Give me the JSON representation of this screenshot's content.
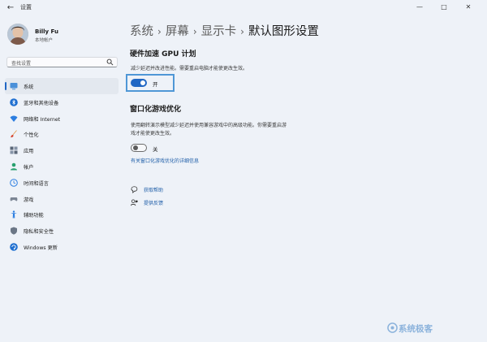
{
  "window": {
    "title": "设置",
    "back_glyph": "←",
    "minimize_glyph": "—",
    "maximize_glyph": "□",
    "close_glyph": "✕"
  },
  "account": {
    "name": "Billy Fu",
    "type": "本地帐户"
  },
  "search": {
    "placeholder": "查找设置"
  },
  "sidebar": {
    "items": [
      {
        "label": "系统",
        "icon": "system-icon",
        "active": true
      },
      {
        "label": "蓝牙和其他设备",
        "icon": "bluetooth-icon"
      },
      {
        "label": "网络和 Internet",
        "icon": "network-icon"
      },
      {
        "label": "个性化",
        "icon": "personalization-icon"
      },
      {
        "label": "应用",
        "icon": "apps-icon"
      },
      {
        "label": "帐户",
        "icon": "accounts-icon"
      },
      {
        "label": "时间和语言",
        "icon": "time-language-icon"
      },
      {
        "label": "游戏",
        "icon": "gaming-icon"
      },
      {
        "label": "辅助功能",
        "icon": "accessibility-icon"
      },
      {
        "label": "隐私和安全性",
        "icon": "privacy-icon"
      },
      {
        "label": "Windows 更新",
        "icon": "windows-update-icon"
      }
    ]
  },
  "breadcrumb": {
    "items": [
      "系统",
      "屏幕",
      "显示卡"
    ],
    "separator": "›",
    "current": "默认图形设置"
  },
  "gpu_scheduling": {
    "title": "硬件加速 GPU 计划",
    "description": "减少延迟并改进性能。需要重启电脑才能使更改生效。",
    "state": "开",
    "enabled": true
  },
  "windowed_games": {
    "title": "窗口化游戏优化",
    "description_line1": "使用翻转演示模型减少延迟并使用兼容游戏中的高级功能。你需要重启游",
    "description_line2": "戏才能使更改生效。",
    "state": "关",
    "enabled": false,
    "more_link": "有关窗口化游戏优化的详细信息"
  },
  "help": {
    "get_help": "获取帮助",
    "feedback": "提供反馈"
  },
  "watermark": {
    "text": "系统极客"
  },
  "colors": {
    "accent": "#2167c4",
    "link": "#1f5ea8",
    "background": "#eef2f8",
    "focus_ring": "#4f97d6"
  }
}
